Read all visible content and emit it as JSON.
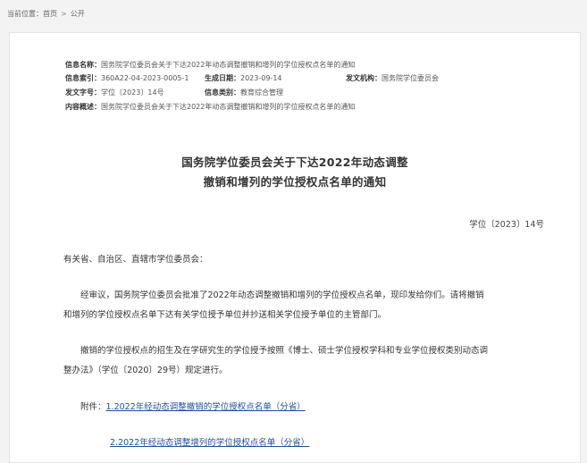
{
  "breadcrumb": {
    "prefix": "当前位置：",
    "home": "首页",
    "sep": ">",
    "current": "公开"
  },
  "meta": {
    "name_label": "信息名称：",
    "name": "国务院学位委员会关于下达2022年动态调整撤销和增列的学位授权点名单的通知",
    "index_label": "信息索引：",
    "index": "360A22-04-2023-0005-1",
    "date_label": "生成日期：",
    "date": "2023-09-14",
    "issuer_label": "发文机构：",
    "issuer": "国务院学位委员会",
    "docno_label": "发文字号：",
    "docno": "学位〔2023〕14号",
    "category_label": "信息类别：",
    "category": "教育综合管理",
    "summary_label": "内容概述：",
    "summary": "国务院学位委员会关于下达2022年动态调整撤销和增列的学位授权点名单的通知"
  },
  "article": {
    "title_line1": "国务院学位委员会关于下达2022年动态调整",
    "title_line2": "撤销和增列的学位授权点名单的通知",
    "doc_number": "学位〔2023〕14号",
    "salutation": "有关省、自治区、直辖市学位委员会：",
    "para1_line1": "经审议，国务院学位委员会批准了2022年动态调整撤销和增列的学位授权点名单，现印发给你们。请将撤销",
    "para1_line2": "和增列的学位授权点名单下达有关学位授予单位并抄送相关学位授予单位的主管部门。",
    "para2_line1": "撤销的学位授权点的招生及在学研究生的学位授予按照《博士、硕士学位授权学科和专业学位授权类别动态调",
    "para2_line2": "整办法》（学位〔2020〕29号）规定进行。",
    "attach_label": "附件：",
    "attachment1": "1.2022年经动态调整撤销的学位授权点名单（分省）",
    "attachment2": "2.2022年经动态调整增列的学位授权点名单（分省）"
  },
  "colors": {
    "link": "#1f4f9f",
    "background": "#f3f3f3"
  }
}
